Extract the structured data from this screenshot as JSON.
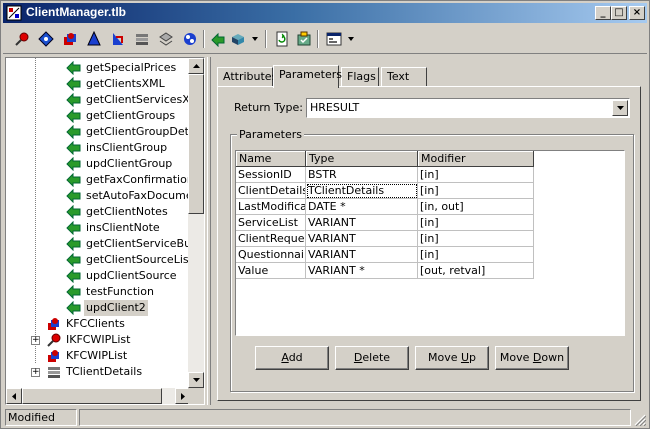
{
  "window": {
    "title": "ClientManager.tlb",
    "min_glyph": "_",
    "max_glyph": "□",
    "close_glyph": "×"
  },
  "toolbar": {
    "icons": [
      "pin-icon",
      "interface-icon",
      "coclass-icon",
      "module-icon",
      "typedef-icon",
      "alias-icon",
      "enum-icon",
      "union-icon",
      "method-icon",
      "property-icon",
      "refresh-icon",
      "register-icon",
      "view-icon"
    ]
  },
  "tree": {
    "items": [
      {
        "label": "getSpecialPrices",
        "kind": "method"
      },
      {
        "label": "getClientsXML",
        "kind": "method"
      },
      {
        "label": "getClientServicesXML",
        "kind": "method"
      },
      {
        "label": "getClientGroups",
        "kind": "method"
      },
      {
        "label": "getClientGroupDetails",
        "kind": "method"
      },
      {
        "label": "insClientGroup",
        "kind": "method"
      },
      {
        "label": "updClientGroup",
        "kind": "method"
      },
      {
        "label": "getFaxConfirmationDc",
        "kind": "method"
      },
      {
        "label": "setAutoFaxDocument",
        "kind": "method"
      },
      {
        "label": "getClientNotes",
        "kind": "method"
      },
      {
        "label": "insClientNote",
        "kind": "method"
      },
      {
        "label": "getClientServiceBund",
        "kind": "method"
      },
      {
        "label": "getClientSourceList",
        "kind": "method"
      },
      {
        "label": "updClientSource",
        "kind": "method"
      },
      {
        "label": "testFunction",
        "kind": "method"
      },
      {
        "label": "updClient2",
        "kind": "method",
        "selected": true
      }
    ],
    "roots": [
      {
        "label": "KFCClients",
        "kind": "coclass",
        "expander": ""
      },
      {
        "label": "IKFCWIPList",
        "kind": "interface",
        "expander": "+"
      },
      {
        "label": "KFCWIPList",
        "kind": "coclass",
        "expander": ""
      },
      {
        "label": "TClientDetails",
        "kind": "record",
        "expander": "+"
      }
    ]
  },
  "tabs": [
    "Attributes",
    "Parameters",
    "Flags",
    "Text"
  ],
  "active_tab": "Parameters",
  "return_type": {
    "label": "Return Type:",
    "value": "HRESULT"
  },
  "parameters": {
    "group_label": "Parameters",
    "columns": [
      "Name",
      "Type",
      "Modifier"
    ],
    "rows": [
      [
        "SessionID",
        "BSTR",
        "[in]"
      ],
      [
        "ClientDetails",
        "TClientDetails",
        "[in]"
      ],
      [
        "LastModification",
        "DATE *",
        "[in, out]"
      ],
      [
        "ServiceList",
        "VARIANT",
        "[in]"
      ],
      [
        "ClientRequests",
        "VARIANT",
        "[in]"
      ],
      [
        "Questionnaire",
        "VARIANT",
        "[in]"
      ],
      [
        "Value",
        "VARIANT *",
        "[out, retval]"
      ]
    ]
  },
  "buttons": {
    "add": "Add",
    "delete": "Delete",
    "move_up": "Move Up",
    "move_down": "Move Down"
  },
  "status": {
    "text": "Modified"
  }
}
